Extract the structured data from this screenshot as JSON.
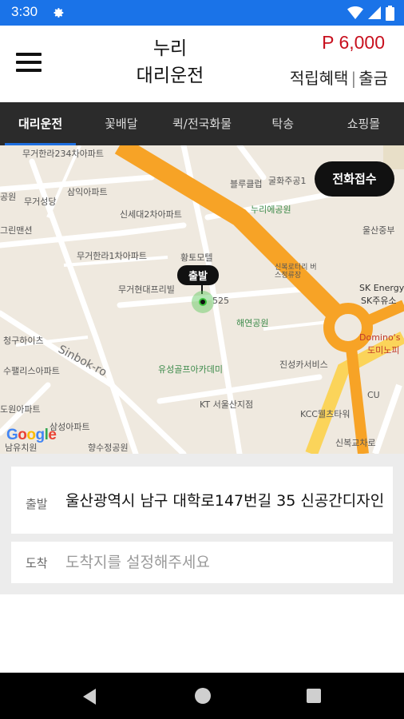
{
  "status_bar": {
    "time": "3:30",
    "icons": [
      "gear-icon",
      "wifi-icon",
      "signal-icon",
      "battery-icon"
    ]
  },
  "header": {
    "title_line1": "누리",
    "title_line2": "대리운전",
    "points": "P 6,000",
    "link_rewards": "적립혜택",
    "link_separator": "|",
    "link_withdraw": "출금"
  },
  "tabs": [
    {
      "label": "대리운전",
      "active": true
    },
    {
      "label": "꽃배달",
      "active": false
    },
    {
      "label": "퀵/전국화물",
      "active": false
    },
    {
      "label": "탁송",
      "active": false
    },
    {
      "label": "쇼핑몰",
      "active": false
    }
  ],
  "map": {
    "call_button": "전화접수",
    "pin_label": "출발",
    "google_logo": "Google",
    "labels": {
      "l1": "무거한라234차아파트",
      "l2": "공원",
      "l3": "삼익아파트",
      "l4": "무거성당",
      "l5": "신세대2차아파트",
      "l6": "그린맨션",
      "l7": "무거한라1차아파트",
      "l8": "황토모텔",
      "l9": "무거현대프리빌",
      "l10": "블루클럽",
      "l11": "굴화주공1",
      "l12": "누리에공원",
      "l13": "울산중부",
      "l14": "신복로터리 버스정류장",
      "l15": "SK Energy",
      "l16": "SK주유소",
      "l17": "525",
      "l18": "해연공원",
      "l19": "Domino's",
      "l20": "도미노피",
      "l21": "청구하이츠",
      "l22": "수팰리스아파트",
      "l23": "Sinbok-ro",
      "l24": "유성골프아카데미",
      "l25": "진성카서비스",
      "l26": "CU",
      "l27": "KT 서울산지점",
      "l28": "KCC웰츠타워",
      "l29": "도원아파트",
      "l30": "삼성아파트",
      "l31": "향수정공원",
      "l32": "신복교차로",
      "l33": "남유치원"
    }
  },
  "address": {
    "start_key": "출발",
    "start_value": "울산광역시 남구 대학로147번길 35 신공간디자인",
    "dest_key": "도착",
    "dest_placeholder": "도착지를 설정해주세요"
  },
  "colors": {
    "status_bar": "#1a73e8",
    "points_red": "#c8101e",
    "tab_bg": "#2b2b2b",
    "tab_indicator": "#1e6fe0",
    "road_orange": "#f7a326",
    "road_yellow": "#fbd45a",
    "map_bg": "#efe9df"
  }
}
